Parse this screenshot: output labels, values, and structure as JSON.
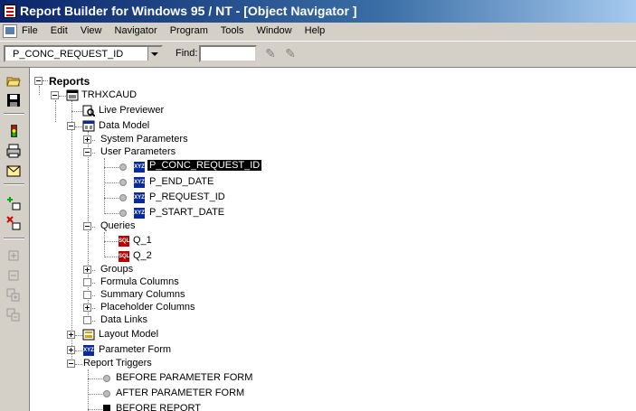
{
  "window": {
    "title": "Report Builder for Windows 95 / NT - [Object Navigator ]"
  },
  "menu": [
    "File",
    "Edit",
    "View",
    "Navigator",
    "Program",
    "Tools",
    "Window",
    "Help"
  ],
  "toolbar": {
    "selected": "P_CONC_REQUEST_ID",
    "find_label": "Find:",
    "find_value": ""
  },
  "tree": {
    "root": "Reports",
    "report": "TRHXCAUD",
    "live_previewer": "Live Previewer",
    "data_model": "Data Model",
    "system_parameters": "System Parameters",
    "user_parameters": "User Parameters",
    "params": [
      "P_CONC_REQUEST_ID",
      "P_END_DATE",
      "P_REQUEST_ID",
      "P_START_DATE"
    ],
    "queries": "Queries",
    "query_items": [
      "Q_1",
      "Q_2"
    ],
    "groups": "Groups",
    "formula_columns": "Formula Columns",
    "summary_columns": "Summary Columns",
    "placeholder_columns": "Placeholder Columns",
    "data_links": "Data Links",
    "layout_model": "Layout Model",
    "parameter_form": "Parameter Form",
    "report_triggers": "Report Triggers",
    "triggers": [
      "BEFORE PARAMETER FORM",
      "AFTER PARAMETER FORM",
      "BEFORE REPORT"
    ]
  }
}
